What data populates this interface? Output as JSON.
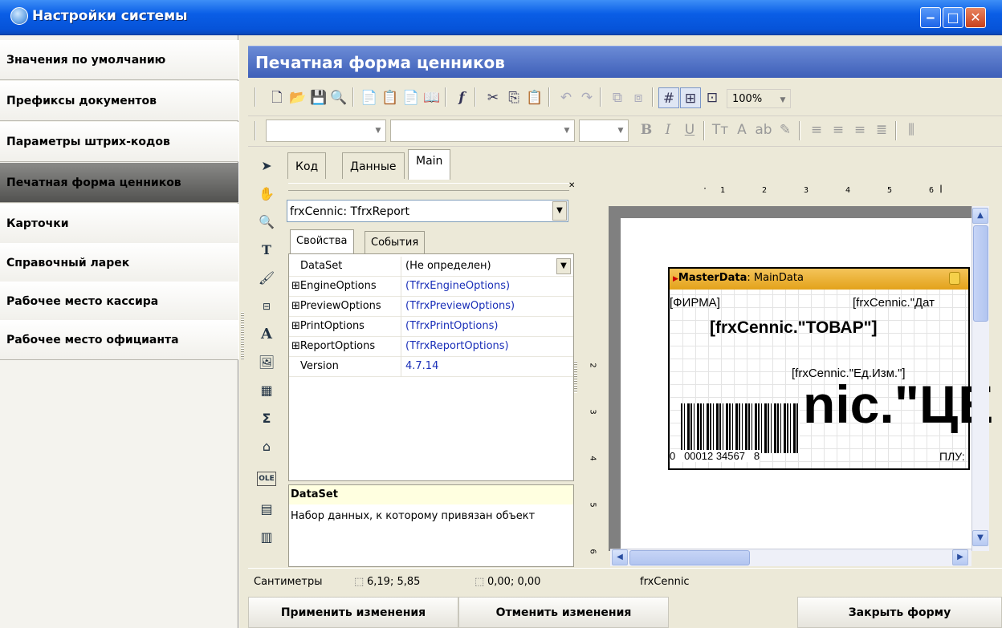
{
  "window": {
    "title": "Настройки системы"
  },
  "sidebar": {
    "items": [
      {
        "label": "Значения по умолчанию"
      },
      {
        "label": "Префиксы документов"
      },
      {
        "label": "Параметры штрих-кодов"
      },
      {
        "label": "Печатная форма ценников"
      },
      {
        "label": "Карточки"
      },
      {
        "label": "Справочный ларек"
      },
      {
        "label": "Рабочее место кассира"
      },
      {
        "label": "Рабочее место официанта"
      }
    ],
    "active_index": 3
  },
  "form": {
    "title": "Печатная форма ценников"
  },
  "toolbar": {
    "zoom": "100%"
  },
  "designer_tabs": [
    {
      "label": "Код"
    },
    {
      "label": "Данные"
    },
    {
      "label": "Main"
    }
  ],
  "inspector": {
    "object": "frxCennic: TfrxReport",
    "tabs": [
      {
        "label": "Свойства"
      },
      {
        "label": "События"
      }
    ],
    "properties": [
      {
        "name": "DataSet",
        "value": "(Не определен)"
      },
      {
        "name": "⊞EngineOptions",
        "value": "(TfrxEngineOptions)"
      },
      {
        "name": "⊞PreviewOptions",
        "value": "(TfrxPreviewOptions)"
      },
      {
        "name": "⊞PrintOptions",
        "value": "(TfrxPrintOptions)"
      },
      {
        "name": "⊞ReportOptions",
        "value": "(TfrxReportOptions)"
      },
      {
        "name": "Version",
        "value": "4.7.14"
      }
    ],
    "help_title": "DataSet",
    "help_text": "Набор данных, к которому привязан объект"
  },
  "report": {
    "band_label": "MasterData",
    "band_dataset": ": MainData",
    "firm": "[ФИРМА]",
    "date": "[frxCennic.\"Дат",
    "product": "[frxCennic.\"ТОВАР\"]",
    "unit": "[frxCennic.\"Ед.Изм.\"]",
    "price": "nic.\"ЦЕ",
    "barcode_number": "0   00012 34567   8",
    "plu": "ПЛУ:"
  },
  "ruler": {
    "top": [
      "1",
      "2",
      "3",
      "4",
      "5",
      "6"
    ],
    "left": [
      "2",
      "3",
      "4",
      "5",
      "6"
    ]
  },
  "status": {
    "units": "Сантиметры",
    "position": "6,19; 5,85",
    "size": "0,00; 0,00",
    "object": "frxCennic"
  },
  "buttons": {
    "apply": "Применить изменения",
    "cancel": "Отменить изменения",
    "close": "Закрыть форму"
  }
}
